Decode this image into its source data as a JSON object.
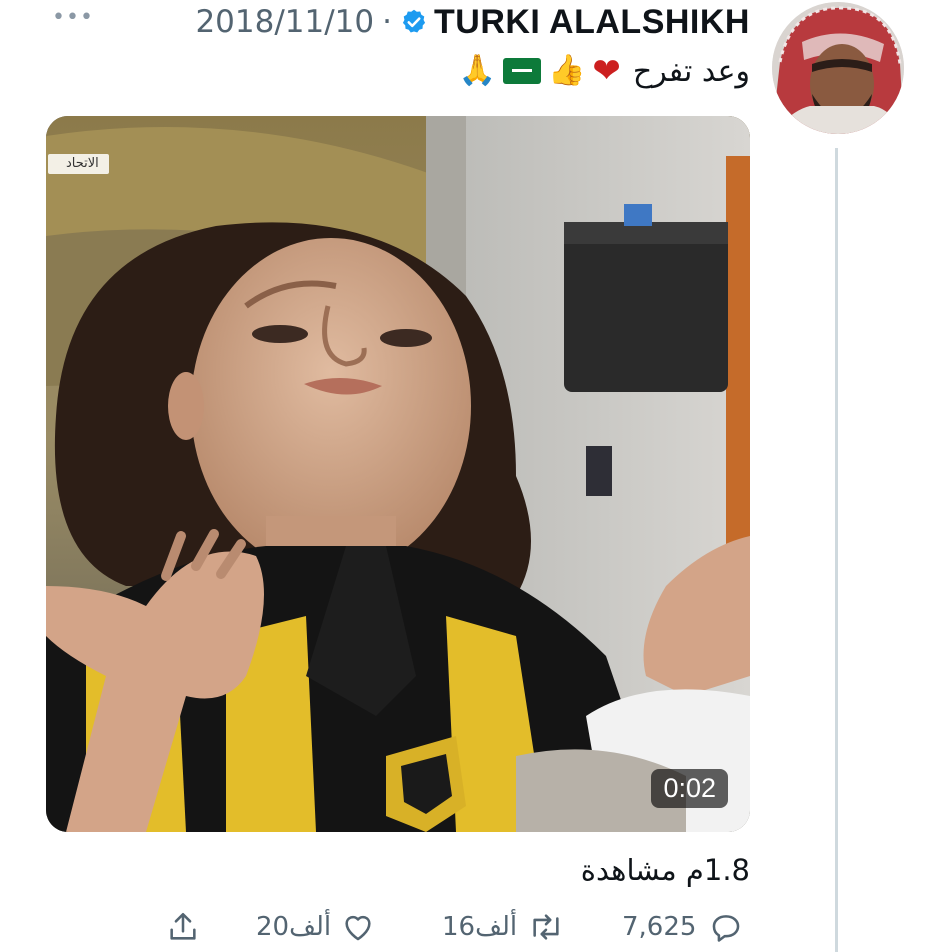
{
  "tweet": {
    "more_icon": "ellipsis-icon",
    "date": "2018/11/10",
    "separator": "·",
    "verified_icon": "verified-badge-icon",
    "author_name": "TURKI ALALSHIKH",
    "text": "وعد تفرح",
    "emojis": [
      "heart-emoji",
      "thumbs-up-emoji",
      "saudi-flag-emoji",
      "praying-hands-emoji"
    ],
    "avatar_icon": "profile-photo"
  },
  "media": {
    "channel_tag": "الاتحاد",
    "duration": "0:02"
  },
  "stats": {
    "views": "1.8م مشاهدة"
  },
  "actions": {
    "replies": "7,625",
    "retweets": "16ألف",
    "likes": "20ألف",
    "reply_icon": "reply-icon",
    "retweet_icon": "retweet-icon",
    "like_icon": "heart-icon",
    "share_icon": "share-icon"
  },
  "colors": {
    "text": "#0f1419",
    "secondary": "#536471",
    "verified": "#1d9bf0",
    "jersey_yellow": "#e8c02a",
    "jersey_black": "#141414"
  }
}
